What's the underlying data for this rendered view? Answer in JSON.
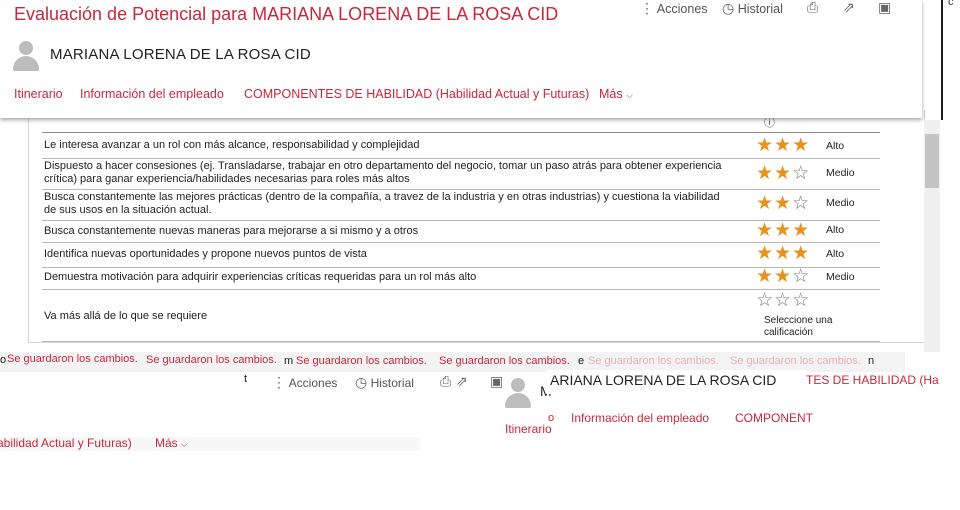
{
  "header": {
    "title": "Evaluación de Potencial para MARIANA LORENA DE LA ROSA CID",
    "employee_name": "MARIANA LORENA DE LA ROSA CID",
    "tabs": [
      "Itinerario",
      "Información del empleado",
      "COMPONENTES DE HABILIDAD (Habilidad Actual y Futuras)",
      "Más"
    ],
    "actions_label": "Acciones",
    "history_label": "Historial"
  },
  "info_icon": "ⓘ",
  "criteria": [
    {
      "text": "Le interesa avanzar a un rol con más alcance, responsabilidad y complejidad",
      "rating": 3,
      "level": "Alto"
    },
    {
      "text": "Dispuesto a hacer consesiones (ej. Transladarse, trabajar en otro departamento del negocio, tomar un paso atrás para obtener experiencia crítica) para ganar experiencia/habilidades necesarias para roles más altos",
      "rating": 2,
      "level": "Medio"
    },
    {
      "text": "Busca constantemente las mejores prácticas (dentro de la compañía, a travez de la industria y en otras industrias) y cuestiona la viabilidad de sus usos en la situación actual.",
      "rating": 2,
      "level": "Medio"
    },
    {
      "text": "Busca constantemente nuevas maneras para mejorarse a si mismo y a otros",
      "rating": 3,
      "level": "Alto"
    },
    {
      "text": "Identifica nuevas oportunidades y propone nuevos puntos de vista",
      "rating": 3,
      "level": "Alto"
    },
    {
      "text": "Demuestra motivación para adquirir experiencias críticas requeridas para un rol más alto",
      "rating": 2,
      "level": "Medio"
    },
    {
      "text": "Va más allá de lo que se requiere",
      "rating": 0,
      "level": "Seleccione una calificación"
    }
  ],
  "toast": {
    "message": "Se guardaron los cambios.",
    "fragments": [
      "o",
      "m",
      "e",
      "n",
      "t",
      "M",
      "o"
    ],
    "corner_char": "c"
  },
  "ghost": {
    "tabs_tail": "TES DE HABILIDAD (Ha",
    "tabs_overflow": "abilidad Actual y Futuras)",
    "name_partial": "ARIANA LORENA DE LA ROSA CID",
    "tabs_partial": [
      "Itinerario",
      "Información del empleado",
      "COMPONENT"
    ]
  },
  "colors": {
    "accent": "#c8283b",
    "star": "#e8921c",
    "star_empty": "#7a7a7a"
  }
}
